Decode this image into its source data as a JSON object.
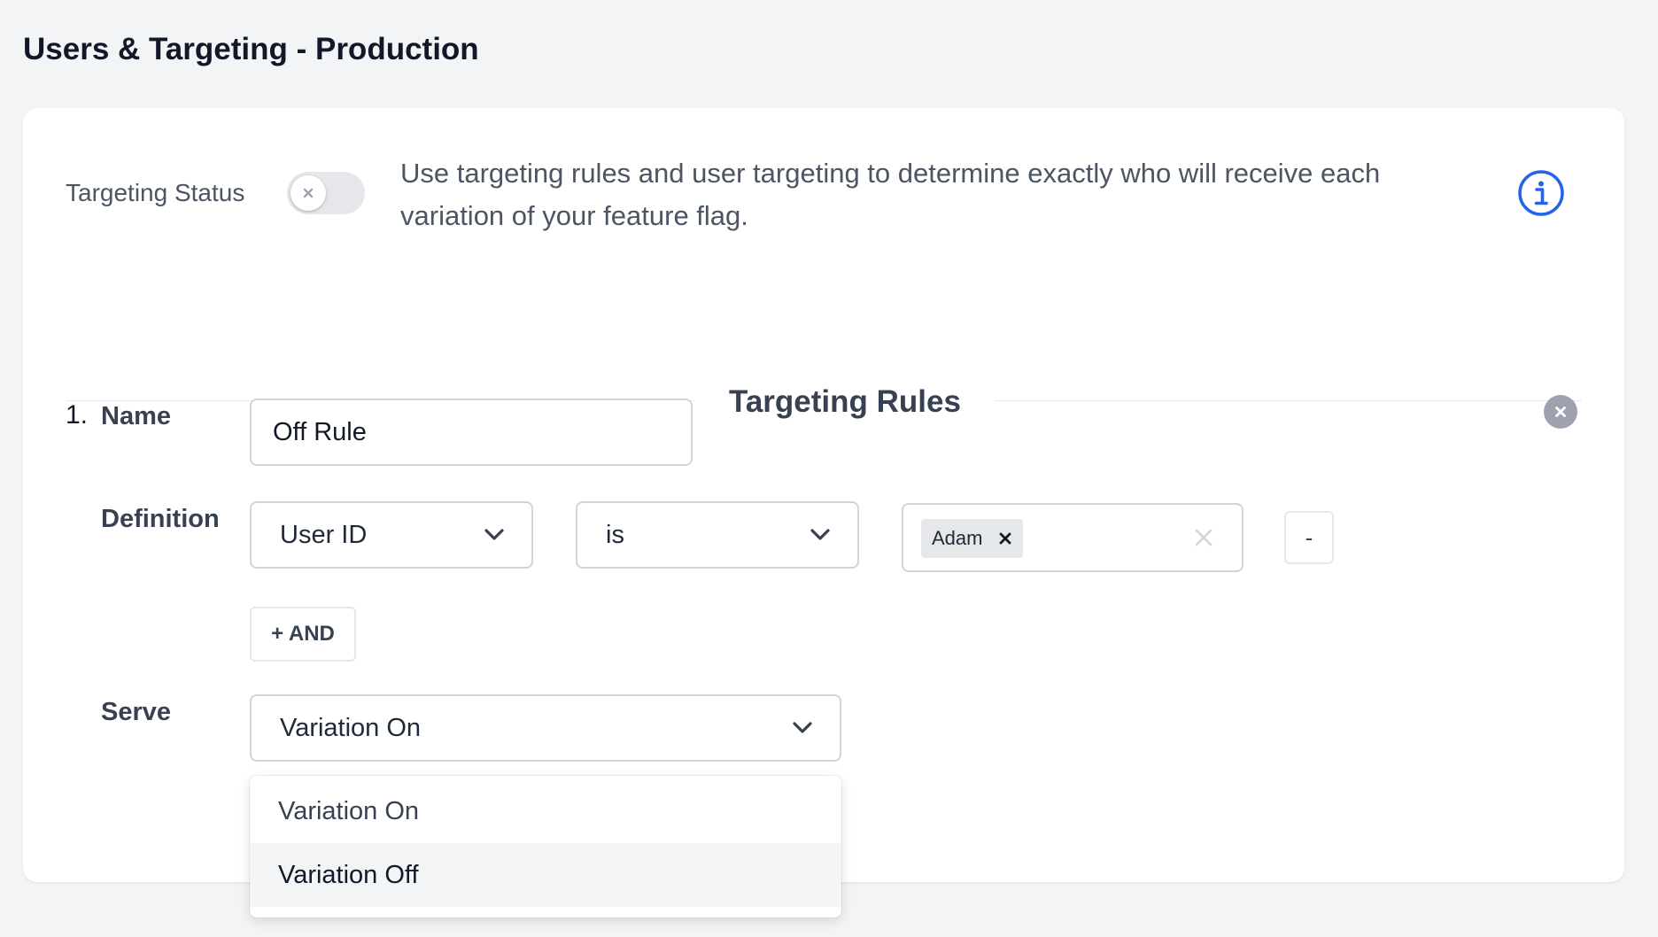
{
  "page": {
    "title": "Users & Targeting - Production"
  },
  "status": {
    "label": "Targeting Status",
    "enabled": false,
    "description": "Use targeting rules and user targeting to determine exactly who will receive each variation of your feature flag."
  },
  "rules_section": {
    "heading": "Targeting Rules"
  },
  "rule": {
    "number": "1.",
    "name_label": "Name",
    "name_value": "Off Rule",
    "definition_label": "Definition",
    "attribute": "User ID",
    "operator": "is",
    "values": [
      "Adam"
    ],
    "remove_condition_label": "-",
    "and_label": "+ AND",
    "serve_label": "Serve",
    "serve_value": "Variation On"
  },
  "serve_options": [
    "Variation On",
    "Variation Off"
  ],
  "colors": {
    "accent": "#2563eb",
    "background": "#f3f4f6",
    "border": "#d1d5db",
    "muted_icon": "#9ca3af"
  },
  "icons": {
    "info": "info-circle-icon",
    "remove_rule": "close-circle-icon",
    "chevron": "chevron-down-icon",
    "toggle_off": "close-icon"
  }
}
